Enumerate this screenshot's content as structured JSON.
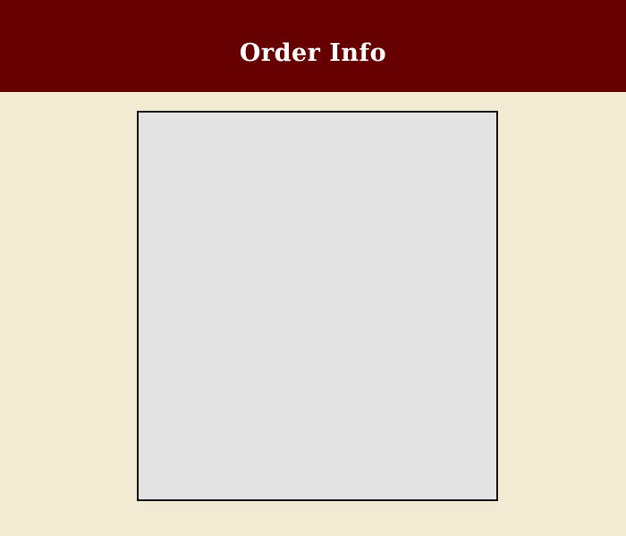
{
  "header": {
    "title": "Order Info",
    "background_color": "#660000",
    "title_color": "#ffffff"
  },
  "page": {
    "background_color": "#f2ead3"
  },
  "order_panel": {
    "background_color": "#e3e3e3",
    "border_color": "#111111"
  }
}
